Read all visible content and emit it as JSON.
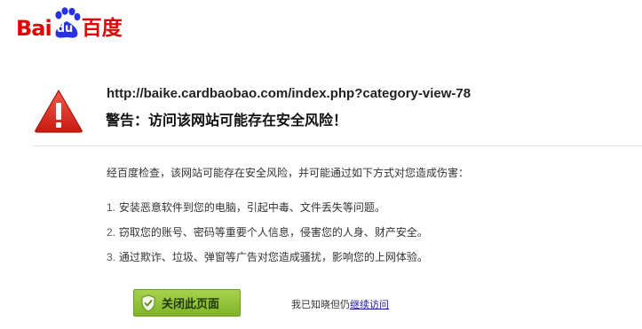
{
  "logo": {
    "left_text": "Bai",
    "paw_text": "du",
    "right_text": "百度",
    "brand_color": "#e10602"
  },
  "warning": {
    "icon": "warning-triangle-icon",
    "url": "http://baike.cardbaobao.com/index.php?category-view-78",
    "title": "警告：访问该网站可能存在安全风险！"
  },
  "body": {
    "intro": "经百度检查，该网站可能存在安全风险，并可能通过如下方式对您造成伤害：",
    "risks": [
      {
        "num": "1.",
        "text": "安装恶意软件到您的电脑，引起中毒、文件丢失等问题。"
      },
      {
        "num": "2.",
        "text": "窃取您的账号、密码等重要个人信息，侵害您的人身、财产安全。"
      },
      {
        "num": "3.",
        "text": "通过欺诈、垃圾、弹窗等广告对您造成骚扰，影响您的上网体验。"
      }
    ]
  },
  "actions": {
    "close_label": "关闭此页面",
    "close_icon": "shield-icon",
    "continue_prefix": "我已知晓但仍",
    "continue_link": "继续访问",
    "button_color": "#8cc03a"
  }
}
